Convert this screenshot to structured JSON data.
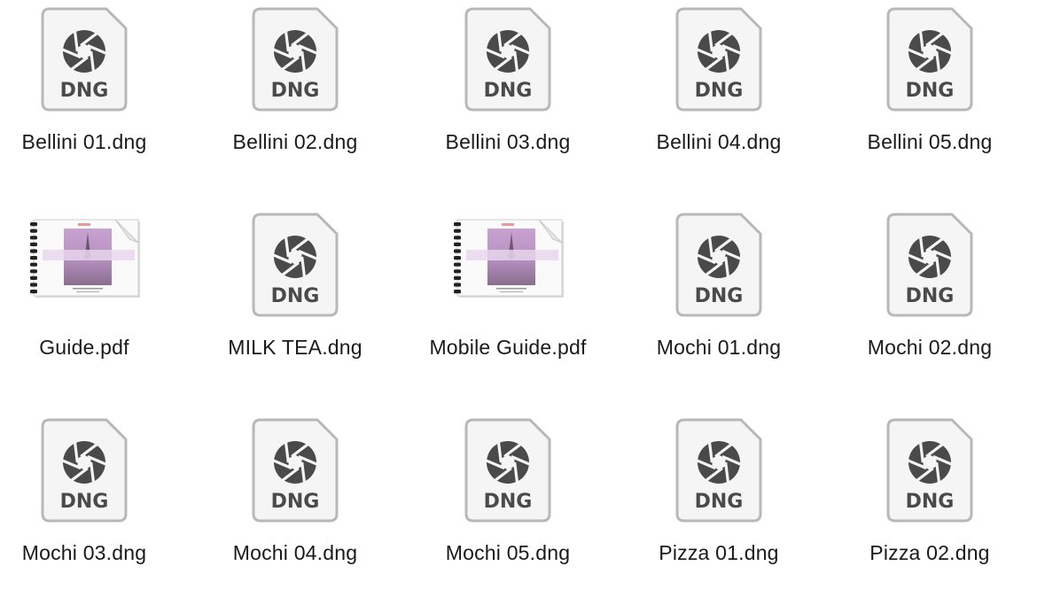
{
  "colors": {
    "doc_border": "#b8b8b8",
    "doc_fill": "#f5f5f5",
    "glyph": "#4a4a4a",
    "text": "#1a1a1a"
  },
  "files": [
    {
      "name": "Bellini 01.dng",
      "kind": "dng",
      "badge": "DNG",
      "icon": "aperture-icon"
    },
    {
      "name": "Bellini 02.dng",
      "kind": "dng",
      "badge": "DNG",
      "icon": "aperture-icon"
    },
    {
      "name": "Bellini 03.dng",
      "kind": "dng",
      "badge": "DNG",
      "icon": "aperture-icon"
    },
    {
      "name": "Bellini 04.dng",
      "kind": "dng",
      "badge": "DNG",
      "icon": "aperture-icon"
    },
    {
      "name": "Bellini 05.dng",
      "kind": "dng",
      "badge": "DNG",
      "icon": "aperture-icon"
    },
    {
      "name": "Guide.pdf",
      "kind": "pdf",
      "badge": "",
      "icon": "pdf-thumbnail-icon"
    },
    {
      "name": "MILK TEA.dng",
      "kind": "dng",
      "badge": "DNG",
      "icon": "aperture-icon"
    },
    {
      "name": "Mobile Guide.pdf",
      "kind": "pdf",
      "badge": "",
      "icon": "pdf-thumbnail-icon"
    },
    {
      "name": "Mochi 01.dng",
      "kind": "dng",
      "badge": "DNG",
      "icon": "aperture-icon"
    },
    {
      "name": "Mochi 02.dng",
      "kind": "dng",
      "badge": "DNG",
      "icon": "aperture-icon"
    },
    {
      "name": "Mochi 03.dng",
      "kind": "dng",
      "badge": "DNG",
      "icon": "aperture-icon"
    },
    {
      "name": "Mochi 04.dng",
      "kind": "dng",
      "badge": "DNG",
      "icon": "aperture-icon"
    },
    {
      "name": "Mochi 05.dng",
      "kind": "dng",
      "badge": "DNG",
      "icon": "aperture-icon"
    },
    {
      "name": "Pizza 01.dng",
      "kind": "dng",
      "badge": "DNG",
      "icon": "aperture-icon"
    },
    {
      "name": "Pizza 02.dng",
      "kind": "dng",
      "badge": "DNG",
      "icon": "aperture-icon"
    }
  ]
}
